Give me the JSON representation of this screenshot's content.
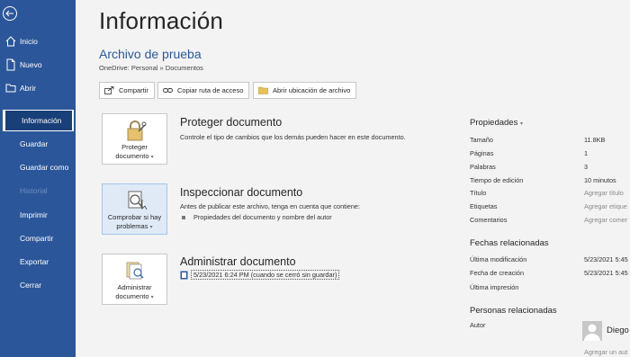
{
  "sidebar": {
    "items": [
      {
        "label": "Inicio"
      },
      {
        "label": "Nuevo"
      },
      {
        "label": "Abrir"
      },
      {
        "label": "Información"
      },
      {
        "label": "Guardar"
      },
      {
        "label": "Guardar como"
      },
      {
        "label": "Historial"
      },
      {
        "label": "Imprimir"
      },
      {
        "label": "Compartir"
      },
      {
        "label": "Exportar"
      },
      {
        "label": "Cerrar"
      }
    ]
  },
  "main": {
    "title": "Información",
    "file_name": "Archivo de prueba",
    "file_path": "OneDrive: Personal » Documentos",
    "toolbar": {
      "share": "Compartir",
      "copy_path": "Copiar ruta de acceso",
      "open_location": "Abrir ubicación de archivo"
    },
    "sections": {
      "protect": {
        "card_line1": "Proteger",
        "card_line2": "documento",
        "title": "Proteger documento",
        "desc": "Controle el tipo de cambios que los demás pueden hacer en este documento."
      },
      "inspect": {
        "card_line1": "Comprobar si hay",
        "card_line2": "problemas",
        "title": "Inspeccionar documento",
        "desc": "Antes de publicar este archivo, tenga en cuenta que contiene:",
        "bullet": "Propiedades del documento y nombre del autor"
      },
      "manage": {
        "card_line1": "Administrar",
        "card_line2": "documento",
        "title": "Administrar documento",
        "version": "5/23/2021 6:24 PM (cuando se cerró sin guardar)"
      }
    }
  },
  "properties": {
    "heading": "Propiedades",
    "rows": [
      {
        "label": "Tamaño",
        "value": "11.8KB"
      },
      {
        "label": "Páginas",
        "value": "1"
      },
      {
        "label": "Palabras",
        "value": "3"
      },
      {
        "label": "Tiempo de edición",
        "value": "10 minutos"
      },
      {
        "label": "Título",
        "value": "Agregar título"
      },
      {
        "label": "Etiquetas",
        "value": "Agregar etique"
      },
      {
        "label": "Comentarios",
        "value": "Agregar comer"
      }
    ],
    "dates_heading": "Fechas relacionadas",
    "dates": [
      {
        "label": "Última modificación",
        "value": "5/23/2021 5:45"
      },
      {
        "label": "Fecha de creación",
        "value": "5/23/2021 5:45"
      },
      {
        "label": "Última impresión",
        "value": ""
      }
    ],
    "people_heading": "Personas relacionadas",
    "author_label": "Autor",
    "author_name": "Diego",
    "add_author": "Agregar un aut"
  },
  "colors": {
    "sidebar": "#2b579a",
    "sidebar_active": "#193f78",
    "accent": "#2b579a"
  }
}
